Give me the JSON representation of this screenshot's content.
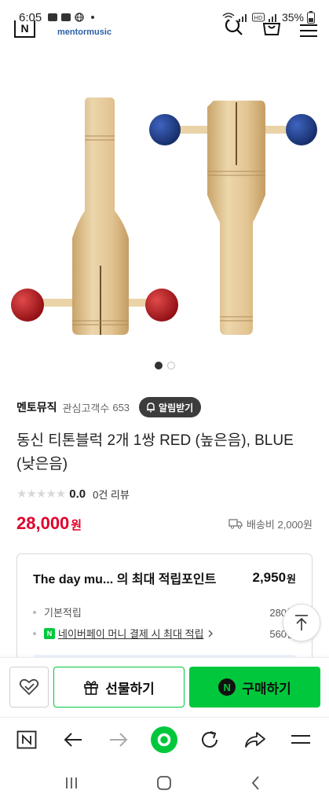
{
  "status_bar": {
    "time": "6:05",
    "battery": "35%",
    "left_icons": [
      "gallery-icon",
      "youtube-icon",
      "globe-icon",
      "dot-icon"
    ],
    "right_icons": [
      "wifi-icon",
      "signal-icon",
      "hd-icon",
      "signal-icon",
      "battery-icon"
    ]
  },
  "header": {
    "logo": "N",
    "brand": "mentormusic",
    "icons": [
      "search-icon",
      "cart-icon",
      "menu-icon"
    ]
  },
  "product_image": {
    "description_icon": "tone-block-image",
    "colors": {
      "red": "#b3151b",
      "blue": "#1c3f8a",
      "wood": "#dcbf8e"
    }
  },
  "carousel": {
    "total": 2,
    "active": 1
  },
  "store": {
    "name": "멘토뮤직",
    "followers_label": "관심고객수",
    "followers_count": "653",
    "notify_label": "알림받기"
  },
  "product": {
    "title": "동신 티톤블럭 2개 1쌍 RED (높은음), BLUE (낮은음)",
    "rating": "0.0",
    "stars_filled": 0,
    "stars_total": 5,
    "review_count": "0건 리뷰",
    "price": "28,000",
    "price_unit": "원",
    "shipping": "배송비 2,000원"
  },
  "points": {
    "title": "The day mu... 의 최대 적립포인트",
    "total": "2,950",
    "total_unit": "원",
    "lines": [
      {
        "label": "기본적립",
        "value": "280원"
      },
      {
        "label": "네이버페이 머니 결제 시 최대 적립",
        "value": "560원"
      }
    ],
    "npay_badge": "N"
  },
  "actions": {
    "gift_label": "선물하기",
    "buy_label": "구매하기",
    "buy_badge": "N"
  },
  "browser_bar": {
    "items": [
      "naver-home-icon",
      "back-arrow-icon",
      "forward-arrow-icon",
      "green-dot-icon",
      "refresh-icon",
      "share-icon",
      "menu-icon"
    ]
  },
  "android_nav": {
    "items": [
      "recent-apps-icon",
      "home-icon",
      "back-icon"
    ]
  },
  "colors": {
    "accent_green": "#00c73c",
    "price_red": "#e0002a"
  }
}
